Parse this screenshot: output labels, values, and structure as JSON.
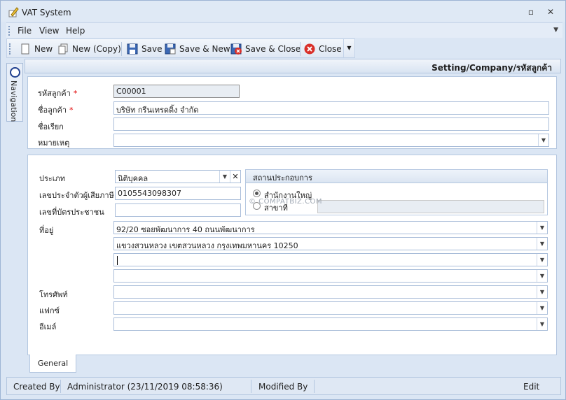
{
  "window": {
    "title": "VAT System"
  },
  "menu": {
    "items": [
      "File",
      "View",
      "Help"
    ]
  },
  "toolbar": {
    "new_label": "New",
    "new_copy_label": "New (Copy)",
    "save_label": "Save",
    "save_new_label": "Save & New",
    "save_close_label": "Save & Close",
    "close_label": "Close"
  },
  "sidebar": {
    "navigation_label": "Navigation"
  },
  "breadcrumb": "Setting/Company/รหัสลูกค้า",
  "customer": {
    "code_label": "รหัสลูกค้า",
    "code_value": "C00001",
    "name_label": "ชื่อลูกค้า",
    "name_value": "บริษัท กรีนเทรดดิ้ง จำกัด",
    "alias_label": "ชื่อเรียก",
    "alias_value": "",
    "note_label": "หมายเหตุ",
    "note_value": "",
    "required_mark": "*"
  },
  "details": {
    "type_label": "ประเภท",
    "type_value": "นิติบุคคล",
    "taxid_label": "เลขประจำตัวผู้เสียภาษี",
    "taxid_value": "0105543098307",
    "idcard_label": "เลขที่บัตรประชาชน",
    "idcard_value": "",
    "address_label": "ที่อยู่",
    "address_lines": [
      "92/20 ซอยพัฒนาการ 40 ถนนพัฒนาการ",
      "แขวงสวนหลวง เขตสวนหลวง กรุงเทพมหานคร 10250",
      "",
      ""
    ],
    "phone_label": "โทรศัพท์",
    "phone_value": "",
    "fax_label": "แฟกซ์",
    "fax_value": "",
    "email_label": "อีเมล์",
    "email_value": ""
  },
  "establishment": {
    "title": "สถานประกอบการ",
    "headoffice_label": "สำนักงานใหญ่",
    "branch_label": "สาขาที่",
    "branch_value": ""
  },
  "watermark": "© COMPATBIZ.COM",
  "tabs": {
    "general": "General"
  },
  "status": {
    "created_by_label": "Created By",
    "created_by_value": "Administrator (23/11/2019 08:58:36)",
    "modified_by_label": "Modified By",
    "mode": "Edit"
  }
}
